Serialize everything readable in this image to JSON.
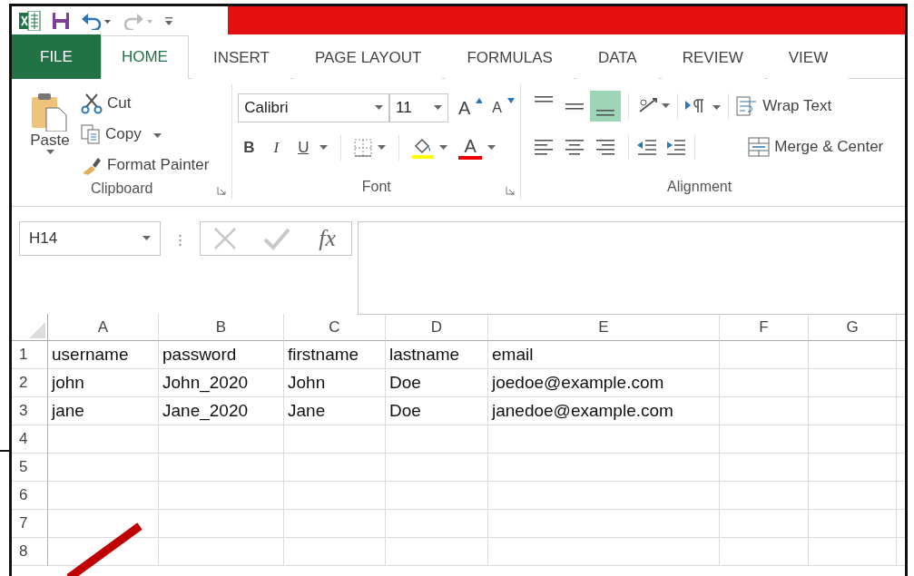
{
  "tabs": [
    {
      "label": "FILE",
      "kind": "file",
      "selected": false
    },
    {
      "label": "HOME",
      "kind": "tab",
      "selected": true
    },
    {
      "label": "INSERT",
      "kind": "tab",
      "selected": false
    },
    {
      "label": "PAGE LAYOUT",
      "kind": "tab",
      "selected": false
    },
    {
      "label": "FORMULAS",
      "kind": "tab",
      "selected": false
    },
    {
      "label": "DATA",
      "kind": "tab",
      "selected": false
    },
    {
      "label": "REVIEW",
      "kind": "tab",
      "selected": false
    },
    {
      "label": "VIEW",
      "kind": "tab",
      "selected": false
    }
  ],
  "ribbon": {
    "clipboard": {
      "label": "Clipboard",
      "paste": "Paste",
      "cut": "Cut",
      "copy": "Copy",
      "format_painter": "Format Painter"
    },
    "font": {
      "label": "Font",
      "font_name": "Calibri",
      "font_size": "11",
      "grow": "A",
      "shrink": "A",
      "bold": "B",
      "italic": "I",
      "underline": "U",
      "font_color": "A"
    },
    "alignment": {
      "label": "Alignment",
      "vertical": [
        {
          "selected": false
        },
        {
          "selected": false
        },
        {
          "selected": true
        }
      ],
      "wrap_text": "Wrap Text",
      "merge_center": "Merge & Center"
    }
  },
  "formula_bar": {
    "name_box": "H14",
    "fx": "fx"
  },
  "sheet": {
    "columns": [
      "A",
      "B",
      "C",
      "D",
      "E",
      "F",
      "G"
    ],
    "rows": [
      {
        "number": "1",
        "cells": [
          "username",
          "password",
          "firstname",
          "lastname",
          "email"
        ]
      },
      {
        "number": "2",
        "cells": [
          "john",
          "John_2020",
          "John",
          "Doe",
          "joedoe@example.com"
        ]
      },
      {
        "number": "3",
        "cells": [
          "jane",
          "Jane_2020",
          "Jane",
          "Doe",
          "janedoe@example.com"
        ]
      },
      {
        "number": "4"
      },
      {
        "number": "5"
      },
      {
        "number": "6"
      },
      {
        "number": "7"
      },
      {
        "number": "8"
      }
    ]
  }
}
